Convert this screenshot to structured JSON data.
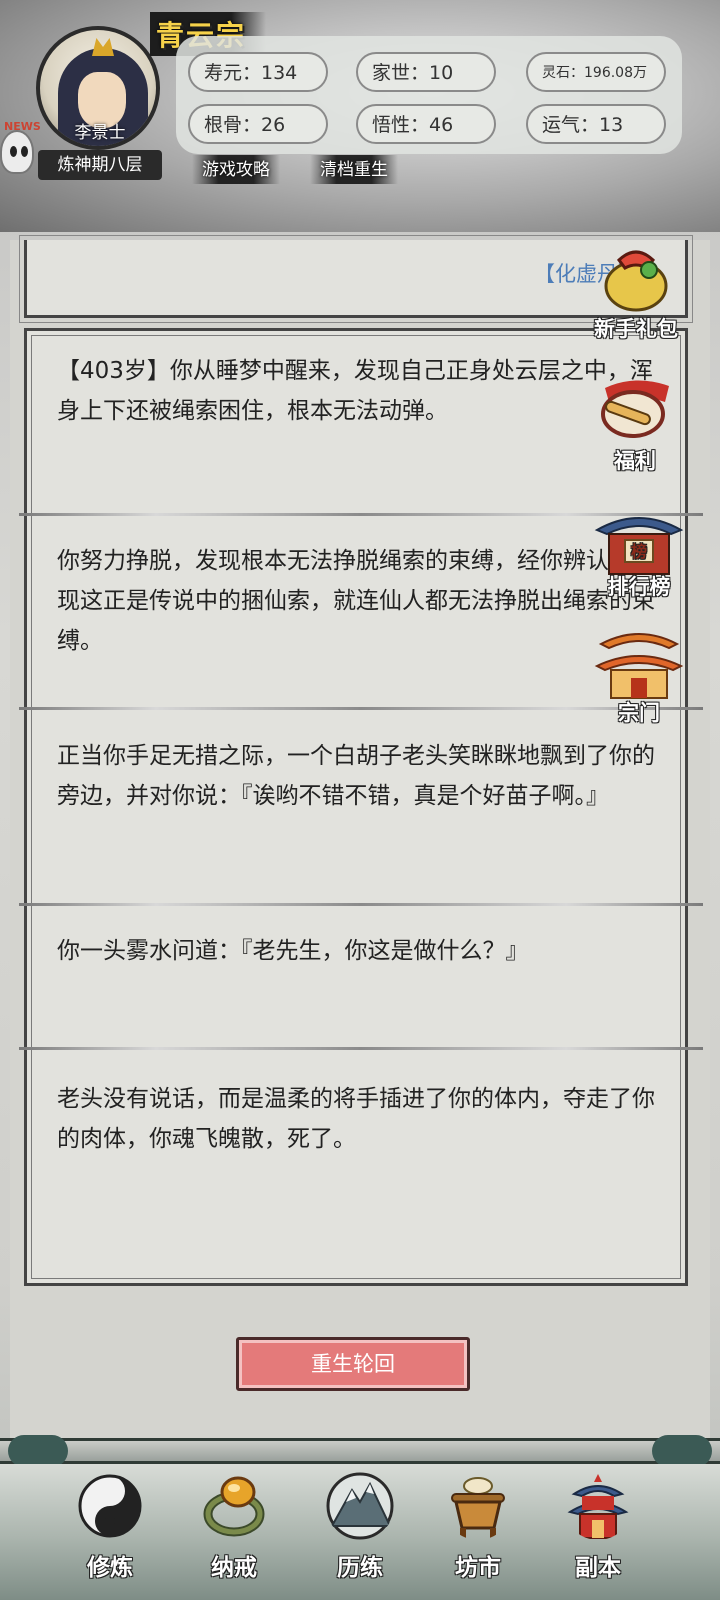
{
  "header": {
    "sect_name": "青云宗",
    "player_name": "李景士",
    "realm": "炼神期八层",
    "news_tag": "NEWS",
    "stats": [
      {
        "label": "寿元：134"
      },
      {
        "label": "家世：10"
      },
      {
        "label": "灵石：196.08万"
      },
      {
        "label": "根骨：26"
      },
      {
        "label": "悟性：46"
      },
      {
        "label": "运气：13"
      }
    ],
    "links": {
      "guide": "游戏攻略",
      "reset": "清档重生"
    }
  },
  "story": {
    "previous_item": "【化虚丹】",
    "paragraphs": [
      "【403岁】你从睡梦中醒来，发现自己正身处云层之中，浑身上下还被绳索困住，根本无法动弹。",
      "你努力挣脱，发现根本无法挣脱绳索的束缚，经你辨认，发现这正是传说中的捆仙索，就连仙人都无法挣脱出绳索的束缚。",
      "正当你手足无措之际，一个白胡子老头笑眯眯地飘到了你的旁边，并对你说：『诶哟不错不错，真是个好苗子啊。』",
      "你一头雾水问道：『老先生，你这是做什么？』",
      "老头没有说话，而是温柔的将手插进了你的体内，夺走了你的肉体，你魂飞魄散，死了。"
    ],
    "rebirth_button": "重生轮回"
  },
  "side_buttons": {
    "gift": "新手礼包",
    "welfare": "福利",
    "ranking": "排行榜",
    "sect": "宗门",
    "ranking_sign": "榜"
  },
  "nav": {
    "items": [
      {
        "label": "修炼",
        "icon": "yin-yang-icon"
      },
      {
        "label": "纳戒",
        "icon": "ring-icon"
      },
      {
        "label": "历练",
        "icon": "mountain-icon",
        "active": true
      },
      {
        "label": "坊市",
        "icon": "cauldron-icon"
      },
      {
        "label": "副本",
        "icon": "pagoda-icon"
      }
    ]
  }
}
